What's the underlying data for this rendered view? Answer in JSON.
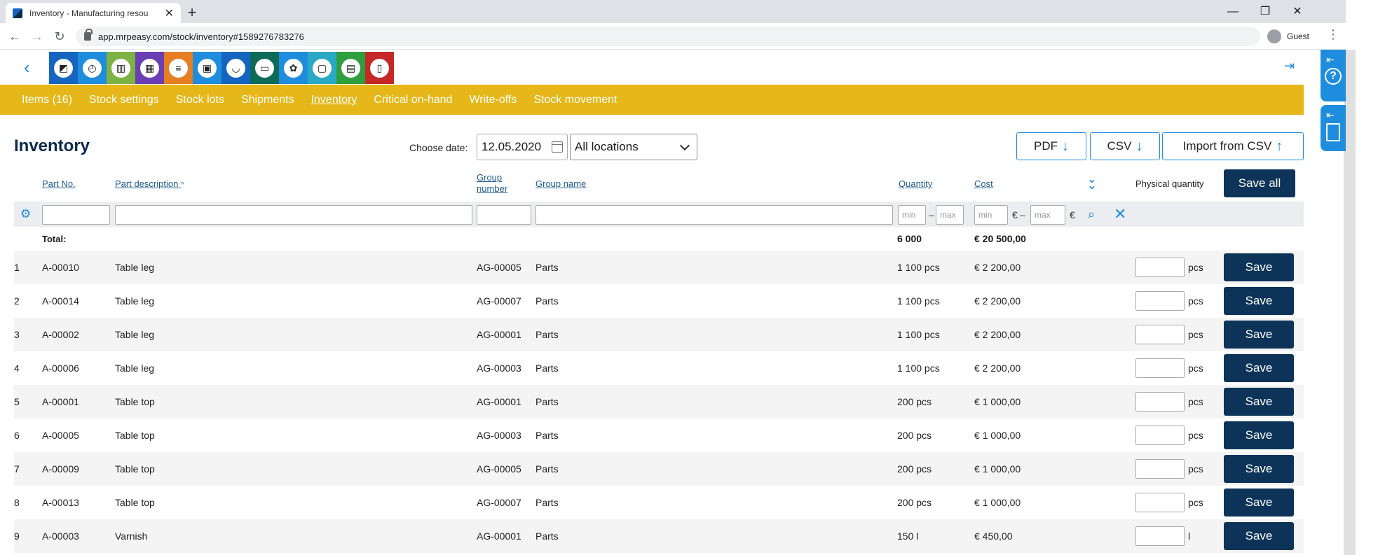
{
  "browser": {
    "tab_title": "Inventory - Manufacturing resou",
    "tab_close": "✕",
    "new_tab": "+",
    "url": "app.mrpeasy.com/stock/inventory#1589276783276",
    "profile": "Guest",
    "win_min": "—",
    "win_max": "❐",
    "win_close": "✕"
  },
  "modules": [
    {
      "icon": "logo-icon",
      "color": "#1565c0"
    },
    {
      "icon": "dashboard-icon",
      "color": "#1f8ddd"
    },
    {
      "icon": "analytics-icon",
      "color": "#7cb342"
    },
    {
      "icon": "calendar-icon",
      "color": "#6a3fb3"
    },
    {
      "icon": "production-icon",
      "color": "#e67e22"
    },
    {
      "icon": "stock-icon",
      "color": "#1f8ddd"
    },
    {
      "icon": "basket-icon",
      "color": "#1565c0"
    },
    {
      "icon": "folder-icon",
      "color": "#0e6b58"
    },
    {
      "icon": "support-icon",
      "color": "#1f8ddd"
    },
    {
      "icon": "presentation-icon",
      "color": "#2aa9c4"
    },
    {
      "icon": "gift-icon",
      "color": "#2e9e3e"
    },
    {
      "icon": "document-icon",
      "color": "#c62828"
    }
  ],
  "menu": [
    {
      "label": "Items (16)"
    },
    {
      "label": "Stock settings"
    },
    {
      "label": "Stock lots"
    },
    {
      "label": "Shipments"
    },
    {
      "label": "Inventory",
      "active": true
    },
    {
      "label": "Critical on-hand"
    },
    {
      "label": "Write-offs"
    },
    {
      "label": "Stock movement"
    }
  ],
  "page": {
    "title": "Inventory",
    "date_label": "Choose date:",
    "date_value": "12.05.2020",
    "location_value": "All locations",
    "pdf": "PDF",
    "csv": "CSV",
    "import": "Import from CSV",
    "save_all": "Save all"
  },
  "headers": {
    "part_no": "Part No.",
    "part_desc": "Part description",
    "sort_indicator": "^",
    "group_number_1": "Group",
    "group_number_2": "number",
    "group_name": "Group name",
    "quantity": "Quantity",
    "cost": "Cost",
    "physical": "Physical quantity"
  },
  "filters": {
    "min": "min",
    "max": "max",
    "dash": "–",
    "euro": "€"
  },
  "totals": {
    "label": "Total:",
    "quantity": "6 000",
    "cost": "€ 20 500,00"
  },
  "rows": [
    {
      "n": "1",
      "part": "A-00010",
      "desc": "Table leg",
      "gnum": "AG-00005",
      "gname": "Parts",
      "qty": "1 100 pcs",
      "cost": "€ 2 200,00",
      "unit": "pcs"
    },
    {
      "n": "2",
      "part": "A-00014",
      "desc": "Table leg",
      "gnum": "AG-00007",
      "gname": "Parts",
      "qty": "1 100 pcs",
      "cost": "€ 2 200,00",
      "unit": "pcs"
    },
    {
      "n": "3",
      "part": "A-00002",
      "desc": "Table leg",
      "gnum": "AG-00001",
      "gname": "Parts",
      "qty": "1 100 pcs",
      "cost": "€ 2 200,00",
      "unit": "pcs"
    },
    {
      "n": "4",
      "part": "A-00006",
      "desc": "Table leg",
      "gnum": "AG-00003",
      "gname": "Parts",
      "qty": "1 100 pcs",
      "cost": "€ 2 200,00",
      "unit": "pcs"
    },
    {
      "n": "5",
      "part": "A-00001",
      "desc": "Table top",
      "gnum": "AG-00001",
      "gname": "Parts",
      "qty": "200 pcs",
      "cost": "€ 1 000,00",
      "unit": "pcs"
    },
    {
      "n": "6",
      "part": "A-00005",
      "desc": "Table top",
      "gnum": "AG-00003",
      "gname": "Parts",
      "qty": "200 pcs",
      "cost": "€ 1 000,00",
      "unit": "pcs"
    },
    {
      "n": "7",
      "part": "A-00009",
      "desc": "Table top",
      "gnum": "AG-00005",
      "gname": "Parts",
      "qty": "200 pcs",
      "cost": "€ 1 000,00",
      "unit": "pcs"
    },
    {
      "n": "8",
      "part": "A-00013",
      "desc": "Table top",
      "gnum": "AG-00007",
      "gname": "Parts",
      "qty": "200 pcs",
      "cost": "€ 1 000,00",
      "unit": "pcs"
    },
    {
      "n": "9",
      "part": "A-00003",
      "desc": "Varnish",
      "gnum": "AG-00001",
      "gname": "Parts",
      "qty": "150 l",
      "cost": "€ 450,00",
      "unit": "l"
    }
  ],
  "row_save": "Save"
}
